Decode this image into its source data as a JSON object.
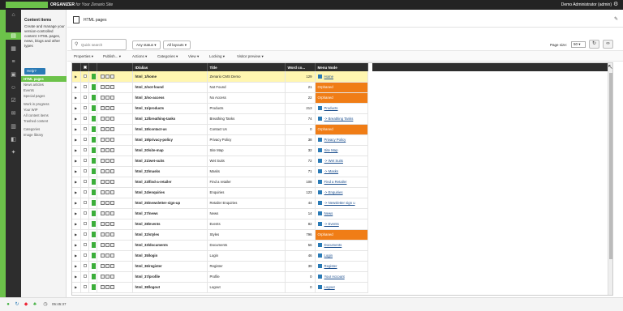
{
  "app": {
    "title": "ORGANIZER",
    "subtitle": "for Your Zenario Site",
    "user": "Demo Administrator (admin)",
    "colors": {
      "brand": "#6cc24a",
      "topbar": "#232323",
      "orphaned": "#f07d16",
      "selected_row": "#fff6b0"
    }
  },
  "nav": {
    "title": "Content items",
    "description": "Create and manage your version-controlled content: HTML pages, news, blogs and other types",
    "help_label": "Help?",
    "items": [
      {
        "label": "HTML pages",
        "active": true
      },
      {
        "label": "News articles"
      },
      {
        "label": "Events"
      },
      {
        "label": "Special pages"
      },
      {
        "label": "Work in progress"
      },
      {
        "label": "Your WIP"
      },
      {
        "label": "All content items"
      },
      {
        "label": "Trashed content"
      },
      {
        "label": "Categories"
      },
      {
        "label": "Image library"
      }
    ]
  },
  "breadcrumb": {
    "label": "HTML pages"
  },
  "filters": {
    "search_placeholder": "Quick search",
    "status": "Any status",
    "layouts": "All layouts",
    "page_size_label": "Page size:",
    "page_size": "50"
  },
  "toolbar": {
    "items": [
      "Properties",
      "Publish...",
      "Actions",
      "Categories",
      "View",
      "Locking",
      "Visitor preview"
    ]
  },
  "grid": {
    "headers": {
      "id": "ID/alias",
      "title": "Title",
      "words": "Word co...",
      "menu": "Menu Node"
    },
    "rows": [
      {
        "id": "html_1/home",
        "title": "Zenario CMS Demo",
        "words": "129",
        "menu": "Home",
        "orphan": false,
        "selected": true
      },
      {
        "id": "html_2/not-found",
        "title": "Not Found",
        "words": "21",
        "menu": "Orphaned",
        "orphan": true
      },
      {
        "id": "html_3/no-access",
        "title": "No Access",
        "words": "22",
        "menu": "Orphaned",
        "orphan": true
      },
      {
        "id": "html_11/products",
        "title": "Products",
        "words": "213",
        "menu": "Products",
        "orphan": false
      },
      {
        "id": "html_12/breathing-tanks",
        "title": "Breathing Tanks",
        "words": "74",
        "menu": "-> Breathing Tanks",
        "orphan": false
      },
      {
        "id": "html_18/contact-us",
        "title": "Contact Us",
        "words": "0",
        "menu": "Orphaned",
        "orphan": true
      },
      {
        "id": "html_19/privacy-policy",
        "title": "Privacy Policy",
        "words": "38",
        "menu": "Privacy Policy",
        "orphan": false
      },
      {
        "id": "html_20/site-map",
        "title": "Site Map",
        "words": "32",
        "menu": "Site Map",
        "orphan": false
      },
      {
        "id": "html_21/wet-suits",
        "title": "Wet Suits",
        "words": "72",
        "menu": "-> Wet Suits",
        "orphan": false
      },
      {
        "id": "html_22/masks",
        "title": "Masks",
        "words": "71",
        "menu": "-> Masks",
        "orphan": false
      },
      {
        "id": "html_23/find-a-retailer",
        "title": "Find a retailer",
        "words": "108",
        "menu": "Find a Retailer",
        "orphan": false
      },
      {
        "id": "html_24/enquiries",
        "title": "Enquiries",
        "words": "123",
        "menu": "-> Enquiries",
        "orphan": false
      },
      {
        "id": "html_25/newsletter-sign-up",
        "title": "Retailer Enquiries",
        "words": "44",
        "menu": "-> Newsletter sign u",
        "orphan": false
      },
      {
        "id": "html_27/news",
        "title": "News",
        "words": "14",
        "menu": "News",
        "orphan": false
      },
      {
        "id": "html_28/events",
        "title": "Events",
        "words": "82",
        "menu": "-> Events",
        "orphan": false
      },
      {
        "id": "html_32/styles",
        "title": "Styles",
        "words": "796",
        "menu": "Orphaned",
        "orphan": true
      },
      {
        "id": "html_33/documents",
        "title": "Documents",
        "words": "56",
        "menu": "Documents",
        "orphan": false
      },
      {
        "id": "html_35/login",
        "title": "Login",
        "words": "46",
        "menu": "Login",
        "orphan": false
      },
      {
        "id": "html_36/register",
        "title": "Register",
        "words": "39",
        "menu": "Register",
        "orphan": false
      },
      {
        "id": "html_37/profile",
        "title": "Profile",
        "words": "0",
        "menu": "Your Account",
        "orphan": false
      },
      {
        "id": "html_38/logout",
        "title": "Logout",
        "words": "0",
        "menu": "Logout",
        "orphan": false
      }
    ]
  },
  "pager": {
    "text": "1 - 23 of 23"
  },
  "status": {
    "time": "05:45:37"
  }
}
